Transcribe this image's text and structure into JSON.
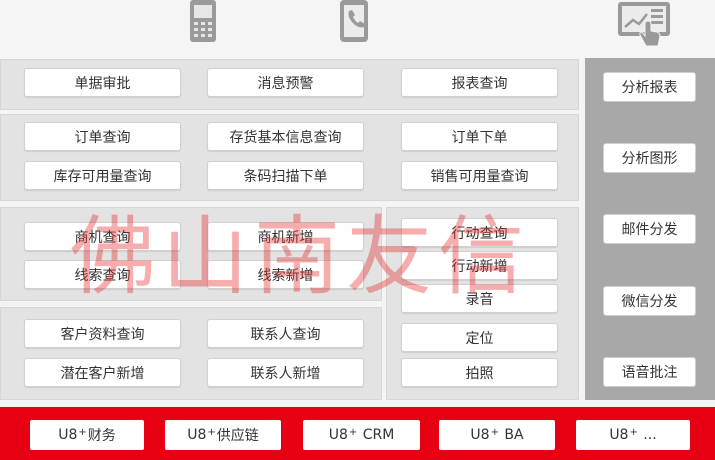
{
  "top_icons": [
    "mobile-phone-icon",
    "phone-call-icon",
    "tablet-touch-icon"
  ],
  "sections": {
    "row1": [
      "单据审批",
      "消息预警",
      "报表查询"
    ],
    "supply_chain": [
      "订单查询",
      "存货基本信息查询",
      "订单下单",
      "库存可用量查询",
      "条码扫描下单",
      "销售可用量查询"
    ],
    "crm": [
      "商机查询",
      "商机新增",
      "线索查询",
      "线索新增"
    ],
    "activity": [
      "行动查询",
      "行动新增",
      "录音",
      "定位",
      "拍照"
    ],
    "customer": [
      "客户资料查询",
      "联系人查询",
      "潜在客户新增",
      "联系人新增"
    ]
  },
  "right_menu": [
    "分析报表",
    "分析图形",
    "邮件分发",
    "微信分发",
    "语音批注"
  ],
  "bottom_bar": [
    {
      "prefix": "U8",
      "sup": "+",
      "suffix": "财务"
    },
    {
      "prefix": "U8",
      "sup": "+",
      "suffix": "供应链"
    },
    {
      "prefix": "U8",
      "sup": "+",
      "suffix": " CRM"
    },
    {
      "prefix": "U8",
      "sup": "+",
      "suffix": " BA"
    },
    {
      "prefix": "U8",
      "sup": "+",
      "suffix": " ..."
    }
  ],
  "watermark": "佛山南友信",
  "colors": {
    "accent_red": "#e60012",
    "panel_gray": "#e3e3e3",
    "right_gray": "#a8a8a8",
    "icon_gray": "#9a9a9a"
  }
}
